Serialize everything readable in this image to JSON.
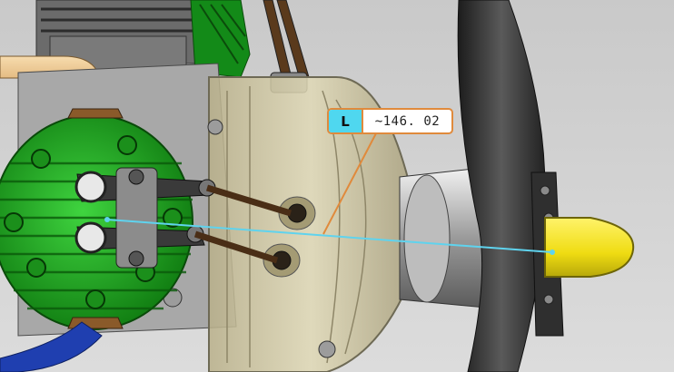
{
  "viewport": {
    "background_top": "#c9c9c9",
    "background_bottom": "#dcdcdc"
  },
  "measurement": {
    "tag": "L",
    "value": "~146. 02",
    "tag_color": "#4fd7ef",
    "border_color": "#e08a3c",
    "line_color": "#5fd3ee"
  },
  "model": {
    "cylinder_head_color": "#1fa51f",
    "spinner_color": "#f2e21a",
    "housing_color": "#cfc79a",
    "intake_pipe_color": "#e8c38a",
    "hose_color": "#1f3fb0",
    "propeller_color": "#2e2e2e"
  }
}
